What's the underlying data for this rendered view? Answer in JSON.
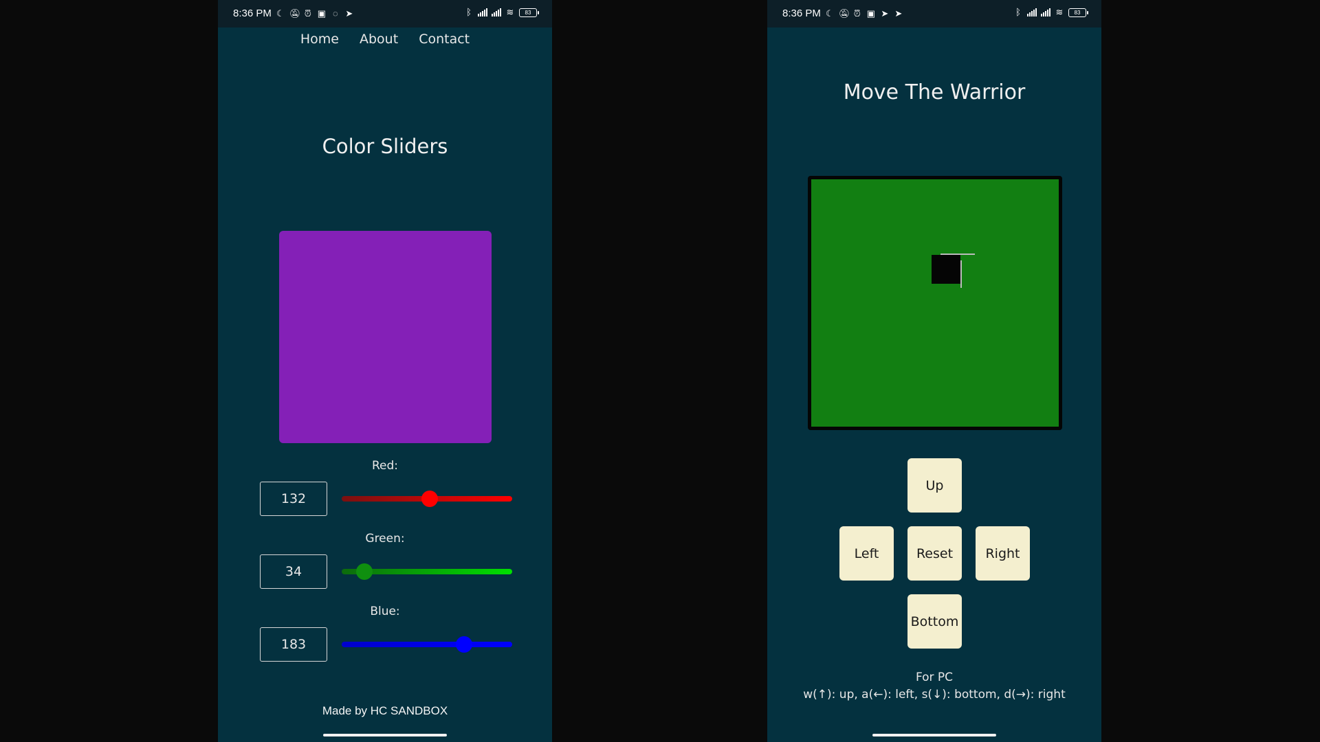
{
  "left_phone": {
    "status": {
      "time": "8:36 PM",
      "left_icons": [
        "moon-icon",
        "bell-off-icon",
        "alarm-icon",
        "nfc-icon",
        "whatsapp-icon",
        "telegram-icon"
      ],
      "right_icons": [
        "bluetooth-icon",
        "signal-icon",
        "signal-icon",
        "wifi-icon"
      ],
      "battery": "83"
    },
    "nav": [
      "Home",
      "About",
      "Contact"
    ],
    "title": "Color Sliders",
    "preview_color": "#8420b7",
    "sliders": [
      {
        "label": "Red:",
        "value": "132",
        "fraction": 0.518,
        "track_start": "#7a1010",
        "track_end": "#ff0000",
        "thumb": "#ff0000"
      },
      {
        "label": "Green:",
        "value": "34",
        "fraction": 0.133,
        "track_start": "#0d6a0d",
        "track_end": "#00e000",
        "thumb": "#0f8f0f"
      },
      {
        "label": "Blue:",
        "value": "183",
        "fraction": 0.718,
        "track_start": "#0000cc",
        "track_end": "#0000ff",
        "thumb": "#0000ff"
      }
    ],
    "footer": "Made by HC SANDBOX"
  },
  "right_phone": {
    "status": {
      "time": "8:36 PM",
      "left_icons": [
        "moon-icon",
        "bell-off-icon",
        "alarm-icon",
        "nfc-icon",
        "telegram-icon",
        "telegram-icon"
      ],
      "right_icons": [
        "bluetooth-icon",
        "signal-icon",
        "signal-icon",
        "wifi-icon"
      ],
      "battery": "83"
    },
    "title": "Move The Warrior",
    "board_color": "#127f12",
    "controls": {
      "up": "Up",
      "left": "Left",
      "reset": "Reset",
      "right": "Right",
      "bottom": "Bottom"
    },
    "help_title": "For PC",
    "help_keys": "w(↑): up, a(←): left, s(↓): bottom, d(→): right"
  }
}
